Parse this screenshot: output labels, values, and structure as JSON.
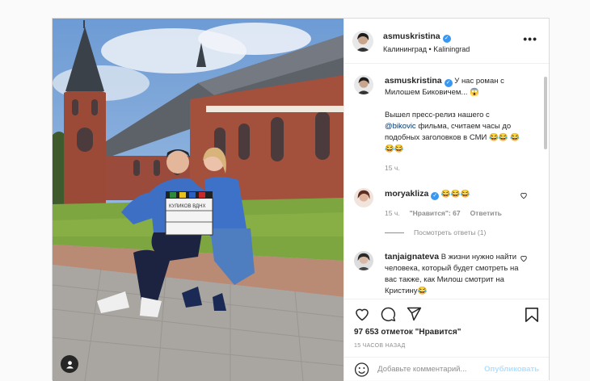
{
  "post": {
    "author": "asmuskristina",
    "location": "Калининград • Kaliningrad",
    "more_label": "•••",
    "caption": {
      "author": "asmuskristina",
      "text_1": "У нас роман с Милошем Биковичем...",
      "emoji_1": "😱",
      "text_2": "Вышел пресс-релиз нашего с",
      "mention": "@bikovic",
      "text_3": "фильма, считаем часы до подобных заголовков в СМИ",
      "emoji_2": "😂😂",
      "emoji_3": "😂😂😂",
      "time": "15 ч."
    },
    "comments": [
      {
        "author": "moryakliza",
        "text": "😂😂😂",
        "time": "15 ч.",
        "likes": "\"Нравится\": 67",
        "reply": "Ответить",
        "view_replies": "Посмотреть ответы (1)"
      },
      {
        "author": "tanjaignateva",
        "text": "В жизни нужно найти человека, который будет смотреть на вас также, как Милош смотрит на Кристину😂"
      }
    ],
    "likes_count": "97 653 отметок \"Нравится\"",
    "timestamp": "15 ЧАСОВ НАЗАД",
    "comment_placeholder": "Добавьте комментарий...",
    "publish_label": "Опубликовать",
    "clapper_text": "КУЛИКОВ   ВДНХ"
  },
  "icons": [
    "user-tag-icon",
    "heart-icon",
    "comment-icon",
    "share-icon",
    "bookmark-icon",
    "emoji-icon",
    "verified-icon",
    "more-icon"
  ],
  "colors": {
    "verified": "#3897f0",
    "publish": "#b2dffc",
    "mention": "#00376b",
    "meta": "#8e8e8e"
  }
}
